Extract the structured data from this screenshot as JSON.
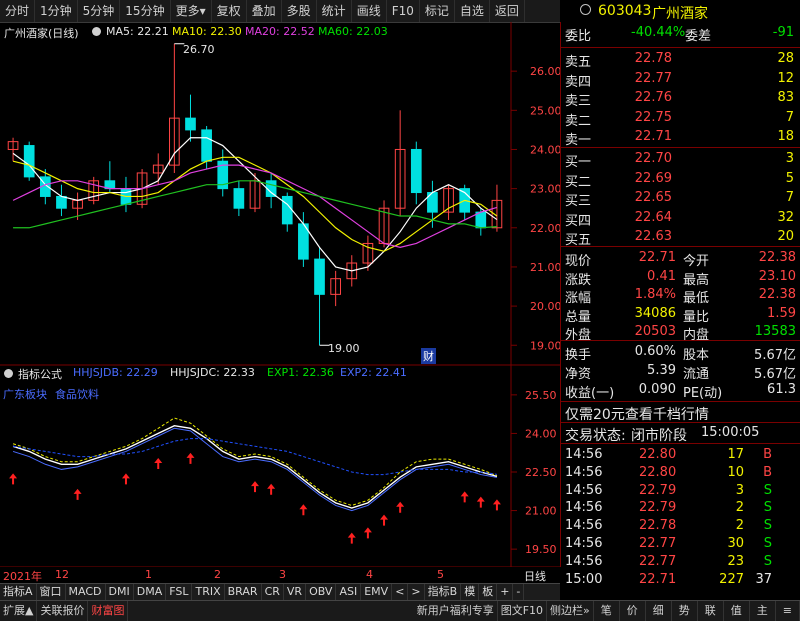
{
  "toolbar": {
    "items": [
      "分时",
      "1分钟",
      "5分钟",
      "15分钟",
      "更多",
      "复权",
      "叠加",
      "多股",
      "统计",
      "画线",
      "F10",
      "标记",
      "自选",
      "返回"
    ]
  },
  "stock": {
    "code": "603043",
    "name": "广州酒家",
    "gear_icon": "settings-icon"
  },
  "main_chart": {
    "title": "广州酒家(日线)",
    "ma5": "MA5: 22.21",
    "ma10": "MA10: 22.30",
    "ma20": "MA20: 22.52",
    "ma60": "MA60: 22.03",
    "high_label": "26.70",
    "low_label": "19.00",
    "cai_badge": "财",
    "y_ticks": [
      "26.00",
      "25.00",
      "24.00",
      "23.00",
      "22.00",
      "21.00",
      "20.00",
      "19.00"
    ]
  },
  "indicator": {
    "title": "指标公式",
    "hhjsjdb": "HHJSJDB: 22.29",
    "hhjsjdc": "HHJSJDC: 22.33",
    "exp1": "EXP1: 22.36",
    "exp2": "EXP2: 22.41",
    "sector_label": "广东板块",
    "industry_label": "食品饮料",
    "y_ticks": [
      "25.50",
      "24.00",
      "22.50",
      "21.00",
      "19.50"
    ]
  },
  "xaxis": {
    "labels": [
      "2021年",
      "12",
      "1",
      "2",
      "3",
      "4",
      "5"
    ],
    "period": "日线"
  },
  "chart_data": [
    {
      "type": "candlestick",
      "title": "广州酒家(日线)",
      "ylim": [
        18.7,
        27.0
      ],
      "x": [
        "2021-11",
        "2021-12",
        "2022-01",
        "2022-02",
        "2022-03",
        "2022-04",
        "2022-05"
      ],
      "ohlc_sample": [
        [
          24.0,
          24.3,
          23.7,
          24.2
        ],
        [
          24.1,
          24.2,
          23.2,
          23.3
        ],
        [
          23.3,
          23.5,
          22.6,
          22.8
        ],
        [
          22.8,
          23.1,
          22.3,
          22.5
        ],
        [
          22.5,
          22.9,
          22.2,
          22.7
        ],
        [
          22.7,
          23.3,
          22.6,
          23.2
        ],
        [
          23.2,
          23.7,
          22.9,
          23.0
        ],
        [
          23.0,
          23.3,
          22.4,
          22.6
        ],
        [
          22.6,
          23.5,
          22.5,
          23.4
        ],
        [
          23.4,
          23.9,
          23.1,
          23.6
        ],
        [
          23.6,
          26.7,
          23.4,
          24.8
        ],
        [
          24.8,
          25.4,
          24.2,
          24.5
        ],
        [
          24.5,
          24.6,
          23.5,
          23.7
        ],
        [
          23.7,
          24.0,
          22.8,
          23.0
        ],
        [
          23.0,
          23.2,
          22.3,
          22.5
        ],
        [
          22.5,
          23.4,
          22.4,
          23.2
        ],
        [
          23.2,
          23.4,
          22.5,
          22.8
        ],
        [
          22.8,
          22.9,
          21.9,
          22.1
        ],
        [
          22.1,
          22.4,
          21.0,
          21.2
        ],
        [
          21.2,
          21.5,
          19.0,
          20.3
        ],
        [
          20.3,
          20.9,
          20.0,
          20.7
        ],
        [
          20.7,
          21.3,
          20.5,
          21.1
        ],
        [
          21.1,
          21.8,
          20.9,
          21.6
        ],
        [
          21.6,
          22.7,
          21.5,
          22.5
        ],
        [
          22.5,
          25.0,
          22.3,
          24.0
        ],
        [
          24.0,
          24.2,
          22.6,
          22.9
        ],
        [
          22.9,
          23.2,
          22.0,
          22.4
        ],
        [
          22.4,
          23.1,
          22.2,
          23.0
        ],
        [
          23.0,
          23.1,
          22.2,
          22.4
        ],
        [
          22.4,
          22.5,
          21.8,
          22.0
        ],
        [
          22.0,
          23.1,
          21.9,
          22.7
        ]
      ],
      "series": [
        {
          "name": "MA5",
          "values": [
            23.9,
            23.6,
            23.1,
            22.8,
            22.7,
            22.8,
            22.9,
            22.9,
            23.0,
            23.2,
            23.9,
            24.3,
            24.3,
            24.1,
            23.7,
            23.3,
            22.9,
            22.6,
            22.1,
            21.5,
            21.0,
            20.9,
            21.0,
            21.4,
            21.9,
            22.5,
            22.9,
            23.1,
            22.9,
            22.5,
            22.21
          ]
        },
        {
          "name": "MA10",
          "values": [
            23.7,
            23.6,
            23.4,
            23.2,
            23.0,
            22.9,
            22.9,
            22.8,
            22.8,
            22.9,
            23.2,
            23.5,
            23.7,
            23.8,
            23.8,
            23.6,
            23.4,
            23.1,
            22.8,
            22.4,
            22.0,
            21.7,
            21.5,
            21.4,
            21.6,
            21.9,
            22.2,
            22.5,
            22.7,
            22.6,
            22.3
          ]
        },
        {
          "name": "MA20",
          "values": [
            22.7,
            22.9,
            23.1,
            23.2,
            23.2,
            23.1,
            23.0,
            23.0,
            23.0,
            23.1,
            23.2,
            23.4,
            23.5,
            23.6,
            23.6,
            23.5,
            23.4,
            23.2,
            23.0,
            22.8,
            22.5,
            22.2,
            21.9,
            21.6,
            21.5,
            21.6,
            21.8,
            22.0,
            22.2,
            22.4,
            22.52
          ]
        },
        {
          "name": "MA60",
          "values": [
            22.0,
            22.0,
            22.1,
            22.2,
            22.3,
            22.4,
            22.5,
            22.6,
            22.7,
            22.8,
            22.9,
            23.0,
            23.1,
            23.1,
            23.2,
            23.2,
            23.1,
            23.0,
            22.9,
            22.8,
            22.7,
            22.6,
            22.5,
            22.4,
            22.3,
            22.3,
            22.2,
            22.1,
            22.1,
            22.0,
            22.03
          ]
        }
      ]
    },
    {
      "type": "line",
      "title": "指标公式",
      "ylim": [
        19.0,
        26.0
      ],
      "series": [
        {
          "name": "HHJSJDB",
          "values": [
            23.3,
            23.1,
            22.8,
            22.6,
            22.7,
            22.9,
            23.1,
            23.3,
            23.6,
            23.9,
            24.2,
            24.1,
            23.6,
            23.1,
            22.9,
            23.0,
            22.9,
            22.6,
            22.1,
            21.6,
            21.2,
            21.0,
            21.2,
            21.7,
            22.2,
            22.6,
            22.7,
            22.8,
            22.6,
            22.4,
            22.29
          ]
        },
        {
          "name": "HHJSJDC",
          "values": [
            23.5,
            23.3,
            23.0,
            22.8,
            22.8,
            23.0,
            23.2,
            23.4,
            23.7,
            24.0,
            24.3,
            24.2,
            23.8,
            23.3,
            23.0,
            23.1,
            23.0,
            22.7,
            22.2,
            21.7,
            21.3,
            21.1,
            21.3,
            21.8,
            22.3,
            22.7,
            22.8,
            22.9,
            22.7,
            22.5,
            22.33
          ]
        },
        {
          "name": "EXP1",
          "values": [
            23.6,
            23.4,
            23.1,
            22.9,
            22.9,
            23.1,
            23.3,
            23.5,
            23.8,
            24.2,
            24.6,
            24.4,
            23.9,
            23.4,
            23.1,
            23.2,
            23.1,
            22.8,
            22.3,
            21.8,
            21.4,
            21.2,
            21.4,
            21.9,
            22.5,
            22.9,
            23.0,
            23.0,
            22.8,
            22.6,
            22.36
          ]
        },
        {
          "name": "EXP2",
          "values": [
            23.5,
            23.4,
            23.3,
            23.2,
            23.1,
            23.1,
            23.2,
            23.2,
            23.3,
            23.5,
            23.7,
            23.8,
            23.8,
            23.7,
            23.6,
            23.5,
            23.4,
            23.3,
            23.1,
            22.9,
            22.7,
            22.5,
            22.4,
            22.4,
            22.5,
            22.6,
            22.6,
            22.6,
            22.5,
            22.5,
            22.41
          ]
        }
      ]
    }
  ],
  "quote": {
    "weibi_label": "委比",
    "weibi": "-40.44%",
    "weicha_label": "委差",
    "weicha": "-91",
    "asks": [
      {
        "label": "卖五",
        "price": "22.78",
        "vol": "28"
      },
      {
        "label": "卖四",
        "price": "22.77",
        "vol": "12"
      },
      {
        "label": "卖三",
        "price": "22.76",
        "vol": "83"
      },
      {
        "label": "卖二",
        "price": "22.75",
        "vol": "7"
      },
      {
        "label": "卖一",
        "price": "22.71",
        "vol": "18"
      }
    ],
    "bids": [
      {
        "label": "买一",
        "price": "22.70",
        "vol": "3"
      },
      {
        "label": "买二",
        "price": "22.69",
        "vol": "5"
      },
      {
        "label": "买三",
        "price": "22.65",
        "vol": "7"
      },
      {
        "label": "买四",
        "price": "22.64",
        "vol": "32"
      },
      {
        "label": "买五",
        "price": "22.63",
        "vol": "20"
      }
    ],
    "stats": [
      {
        "l1": "现价",
        "v1": "22.71",
        "c1": "red",
        "l2": "今开",
        "v2": "22.38",
        "c2": "red"
      },
      {
        "l1": "涨跌",
        "v1": "0.41",
        "c1": "red",
        "l2": "最高",
        "v2": "23.10",
        "c2": "red"
      },
      {
        "l1": "涨幅",
        "v1": "1.84%",
        "c1": "red",
        "l2": "最低",
        "v2": "22.38",
        "c2": "red"
      },
      {
        "l1": "总量",
        "v1": "34086",
        "c1": "yellow",
        "l2": "量比",
        "v2": "1.59",
        "c2": "red"
      },
      {
        "l1": "外盘",
        "v1": "20503",
        "c1": "red",
        "l2": "内盘",
        "v2": "13583",
        "c2": "green"
      }
    ],
    "stats2": [
      {
        "l1": "换手",
        "v1": "0.60%",
        "l2": "股本",
        "v2": "5.67亿"
      },
      {
        "l1": "净资",
        "v1": "5.39",
        "l2": "流通",
        "v2": "5.67亿"
      },
      {
        "l1": "收益(一)",
        "v1": "0.090",
        "l2": "PE(动)",
        "v2": "61.3"
      }
    ],
    "promo": "仅需20元查看千档行情",
    "trade_status_label": "交易状态:",
    "trade_status": "闭市阶段",
    "trade_time": "15:00:05",
    "ticks": [
      {
        "t": "14:56",
        "p": "22.80",
        "v": "17",
        "d": "B"
      },
      {
        "t": "14:56",
        "p": "22.80",
        "v": "10",
        "d": "B"
      },
      {
        "t": "14:56",
        "p": "22.79",
        "v": "3",
        "d": "S"
      },
      {
        "t": "14:56",
        "p": "22.79",
        "v": "2",
        "d": "S"
      },
      {
        "t": "14:56",
        "p": "22.78",
        "v": "2",
        "d": "S"
      },
      {
        "t": "14:56",
        "p": "22.77",
        "v": "30",
        "d": "S"
      },
      {
        "t": "14:56",
        "p": "22.77",
        "v": "23",
        "d": "S"
      },
      {
        "t": "15:00",
        "p": "22.71",
        "v": "227",
        "d": "37"
      }
    ]
  },
  "indicator_tabs": [
    "指标A",
    "窗口",
    "MACD",
    "DMI",
    "DMA",
    "FSL",
    "TRIX",
    "BRAR",
    "CR",
    "VR",
    "OBV",
    "ASI",
    "EMV",
    "<",
    ">",
    "指标B",
    "模",
    "板",
    "+",
    "-"
  ],
  "bottom_bar": {
    "left": [
      "扩展▲",
      "关联报价",
      "财富图"
    ],
    "right": [
      "新用户福利专享",
      "图文F10",
      "侧边栏"
    ],
    "right_icons": [
      "笔",
      "价",
      "细",
      "势",
      "联",
      "值",
      "主",
      "≡"
    ]
  },
  "colors": {
    "up": "#ff4545",
    "down": "#00e0e0",
    "ma5": "#ffffff",
    "ma10": "#f2f200",
    "ma20": "#e040e0",
    "ma60": "#20c020",
    "axis": "#7a0000"
  }
}
